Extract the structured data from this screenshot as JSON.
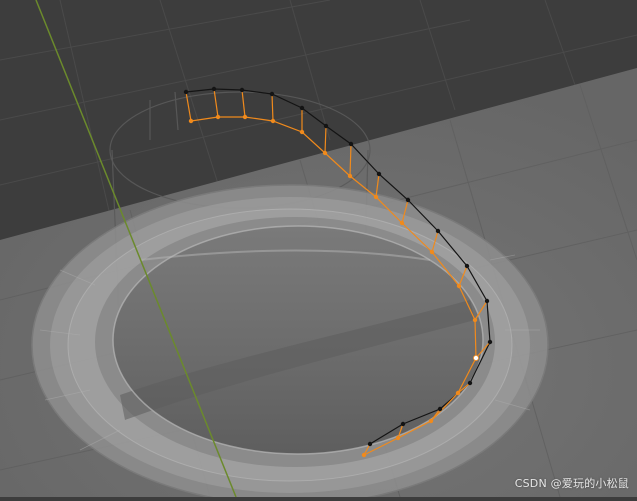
{
  "viewport": {
    "colors": {
      "background_dark": "#3d3d3d",
      "floor": "#6e6e6e",
      "grid_line": "#545454",
      "y_axis": "#6b8a2c",
      "edge_black": "#141414",
      "edge_selected": "#f08a1c",
      "vertex_active": "#ffffff"
    }
  },
  "watermark": {
    "text": "CSDN @爱玩的小松鼠"
  }
}
